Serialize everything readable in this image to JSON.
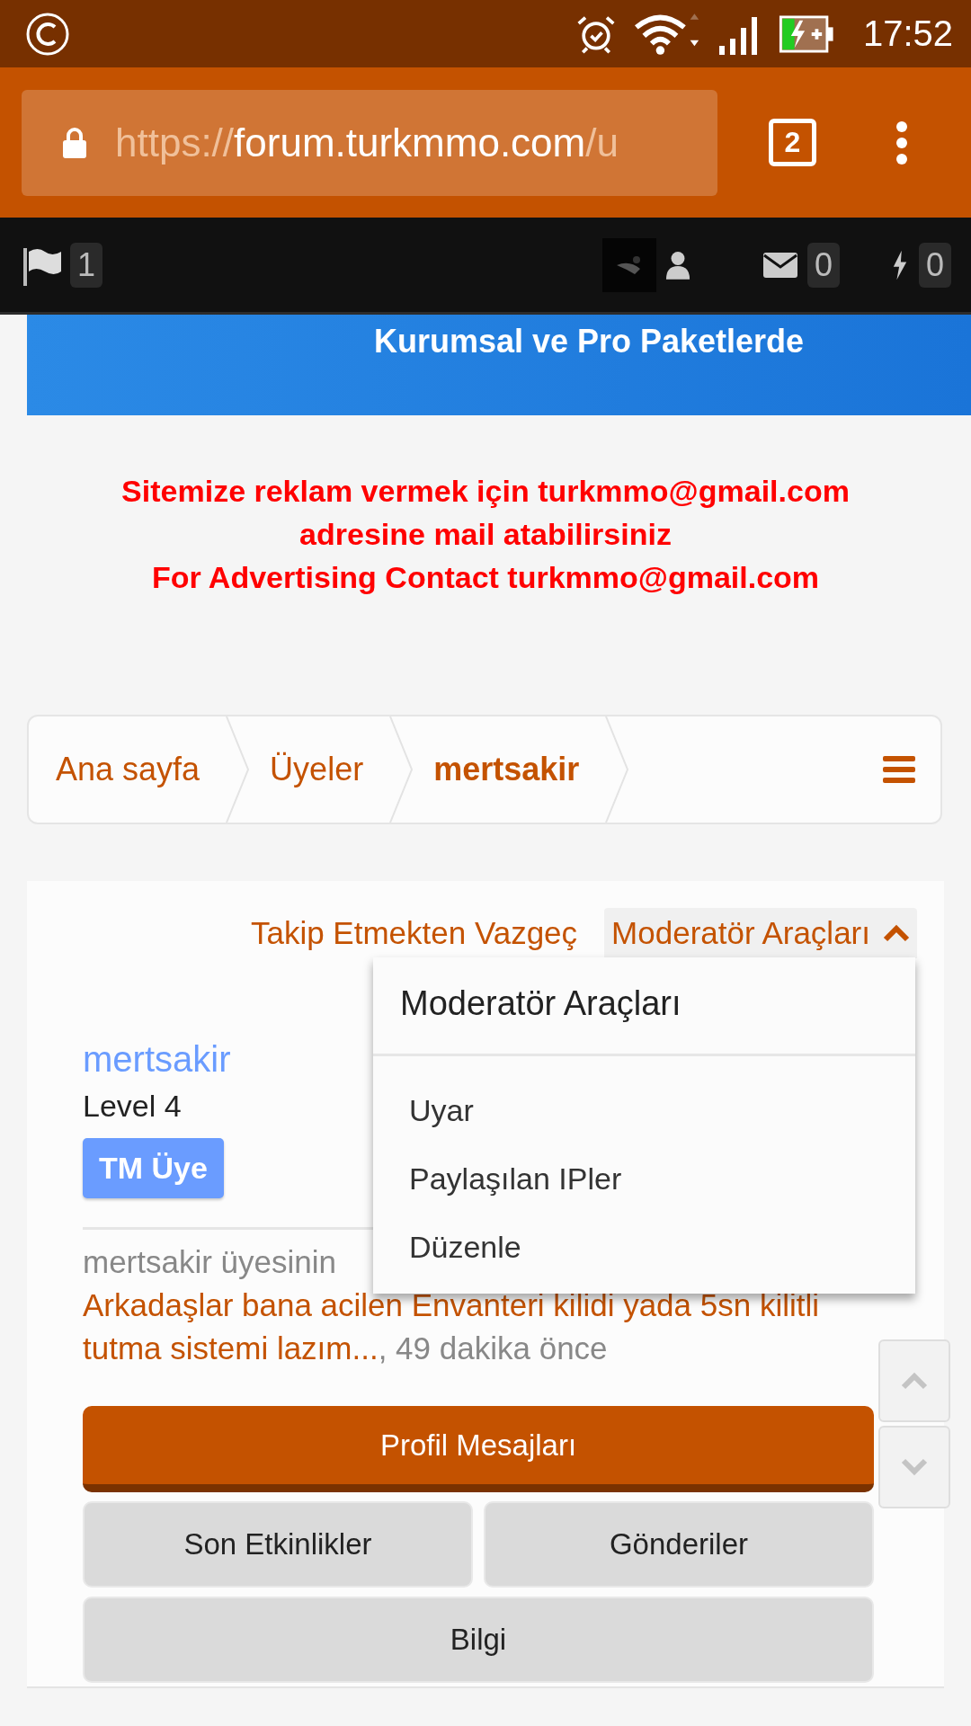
{
  "status_bar": {
    "time": "17:52"
  },
  "browser": {
    "url_scheme": "https://",
    "url_host": "forum.turkmmo.com",
    "url_rest": "/u",
    "tab_count": "2"
  },
  "nav": {
    "alerts_count": "1",
    "messages_count": "0",
    "notifications_count": "0"
  },
  "banner": {
    "text": "Kurumsal ve Pro Paketlerde"
  },
  "ad_notice": [
    "Sitemize reklam vermek için turkmmo@gmail.com",
    "adresine mail atabilirsiniz",
    "For Advertising Contact turkmmo@gmail.com"
  ],
  "breadcrumb": [
    {
      "label": "Ana sayfa",
      "selected": false
    },
    {
      "label": "Üyeler",
      "selected": false
    },
    {
      "label": "mertsakir",
      "selected": true
    }
  ],
  "profile": {
    "actions": [
      {
        "label": "Takip Etmekten Vazgeç",
        "kind": "link"
      },
      {
        "label": "Moderatör Araçları",
        "kind": "menu",
        "expanded": true
      }
    ],
    "username": "mertsakir",
    "title": "Level 4",
    "badge": "TM Üye",
    "status_prefix": "mertsakir üyesinin",
    "status_link": "Arkadaşlar bana acilen Envanteri kilidi yada 5sn kilitli tutma sistemi lazım...",
    "status_tail": ", 49 dakika önce",
    "tabs": [
      {
        "label": "Profil Mesajları",
        "selected": true
      },
      {
        "label": "Son Etkinlikler",
        "selected": false
      },
      {
        "label": "Gönderiler",
        "selected": false
      },
      {
        "label": "Bilgi",
        "selected": false
      }
    ]
  },
  "dropdown": {
    "title": "Moderatör Araçları",
    "items": [
      "Uyar",
      "Paylaşılan IPler",
      "Düzenle"
    ]
  }
}
